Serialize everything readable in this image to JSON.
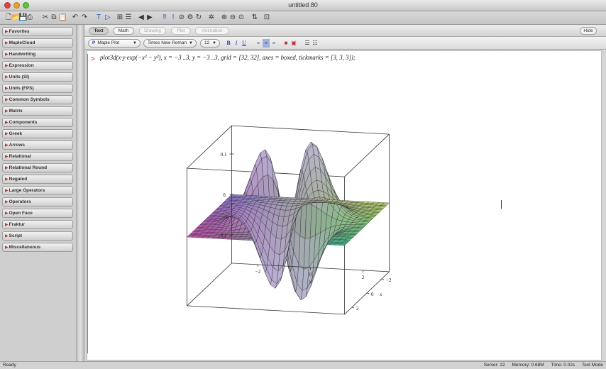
{
  "window": {
    "title": "untitled 80"
  },
  "colors": {
    "prompt": "#c0392b",
    "palette_triangle": "#b23a3a",
    "selected_format": "#1a3fa0"
  },
  "toolbar": {
    "icons": [
      "new-document-icon",
      "open-icon",
      "save-icon",
      "print-icon",
      "cut-icon",
      "copy-icon",
      "paste-icon",
      "undo-icon",
      "redo-icon",
      "text-insert-icon",
      "math-insert-icon",
      "execution-group-icon",
      "section-icon",
      "back-icon",
      "forward-icon",
      "execute-icon",
      "debug-icon",
      "stop-icon",
      "restart-icon",
      "restart-kernel-icon",
      "settings-icon",
      "zoom-in-icon",
      "zoom-out-icon",
      "zoom-reset-icon",
      "toggle-icon",
      "help-icon"
    ]
  },
  "palettes": [
    "Favorites",
    "MapleCloud",
    "Handwriting",
    "Expression",
    "Units (SI)",
    "Units (FPS)",
    "Common Symbols",
    "Matrix",
    "Components",
    "Greek",
    "Arrows",
    "Relational",
    "Relational Round",
    "Negated",
    "Large Operators",
    "Operators",
    "Open Face",
    "Fraktur",
    "Script",
    "Miscellaneous"
  ],
  "context_bar": {
    "modes": [
      {
        "label": "Text",
        "state": "selected"
      },
      {
        "label": "Math",
        "state": "enabled"
      },
      {
        "label": "Drawing",
        "state": "disabled"
      },
      {
        "label": "Plot",
        "state": "disabled"
      },
      {
        "label": "Animation",
        "state": "disabled"
      }
    ],
    "hide_label": "Hide"
  },
  "format_bar": {
    "style": "Maple Plot",
    "font": "Times New Roman",
    "size": "12",
    "bold": "B",
    "italic": "I",
    "underline": "U"
  },
  "document": {
    "prompt": ">",
    "command": "plot3d(x·y·exp(−x² − y²), x = −3 ..3, y = −3 ..3, grid = [32, 32], axes = boxed, tickmarks = [3, 3, 3]);"
  },
  "plot": {
    "z_ticks": [
      "0.1",
      "0.",
      "−0.1"
    ],
    "y_ticks": [
      "−2",
      "0",
      "2"
    ],
    "x_ticks": [
      "−2",
      "0",
      "2"
    ],
    "y_label": "y",
    "x_label": "x",
    "colors": {
      "pink": "#d04fb2",
      "purple": "#8e7fd8",
      "green": "#3fbf8f",
      "yellow": "#c5d66a",
      "lavender": "#c9bde8",
      "grid": "#222222",
      "box": "#333333"
    }
  },
  "status": {
    "left": "Ready",
    "server": "Server: 22",
    "memory": "Memory: 0.68M",
    "time": "Time: 0.02s",
    "mode": "Text Mode"
  }
}
